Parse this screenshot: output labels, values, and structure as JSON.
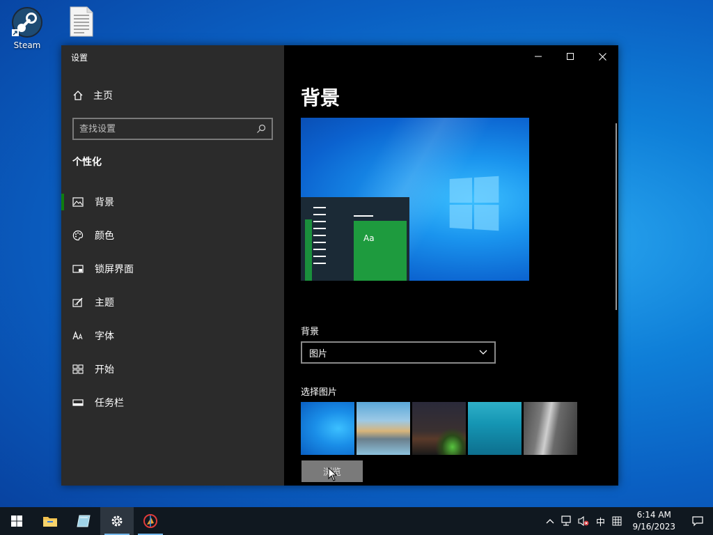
{
  "desktop": {
    "icons": [
      {
        "label": "Steam",
        "icon": "steam-icon"
      },
      {
        "label": "",
        "icon": "document-icon"
      }
    ]
  },
  "window": {
    "title": "设置",
    "controls": {
      "minimize": "—",
      "maximize": "☐",
      "close": "✕"
    }
  },
  "sidebar": {
    "home_label": "主页",
    "search_placeholder": "查找设置",
    "section_title": "个性化",
    "items": [
      {
        "label": "背景",
        "icon": "picture-icon",
        "active": true
      },
      {
        "label": "颜色",
        "icon": "palette-icon"
      },
      {
        "label": "锁屏界面",
        "icon": "lock-screen-icon"
      },
      {
        "label": "主题",
        "icon": "theme-icon"
      },
      {
        "label": "字体",
        "icon": "font-icon"
      },
      {
        "label": "开始",
        "icon": "start-icon"
      },
      {
        "label": "任务栏",
        "icon": "taskbar-icon"
      }
    ]
  },
  "content": {
    "page_title": "背景",
    "preview_tile_text": "Aa",
    "background_label": "背景",
    "background_value": "图片",
    "choose_picture_label": "选择图片",
    "thumbnails": [
      {
        "name": "windows-blue"
      },
      {
        "name": "beach-rocks"
      },
      {
        "name": "night-sky-tent"
      },
      {
        "name": "underwater-swimmer"
      },
      {
        "name": "rock-cliff"
      }
    ],
    "browse_label": "浏览"
  },
  "taskbar": {
    "apps": [
      "windows-start",
      "file-explorer",
      "app-sketch",
      "settings",
      "app-picker"
    ],
    "tray": {
      "ime": "中",
      "time": "6:14 AM",
      "date": "9/16/2023"
    }
  },
  "colors": {
    "accent": "#107c10",
    "sidebar_bg": "#2b2b2b",
    "content_bg": "#000000",
    "taskbar_bg": "#101820"
  }
}
